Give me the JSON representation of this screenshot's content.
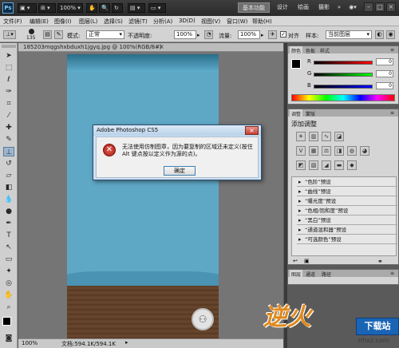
{
  "topbar": {
    "logo": "Ps",
    "zoom": "100%",
    "workspaces": [
      "基本功能",
      "设计",
      "绘画",
      "摄影"
    ],
    "window_buttons": [
      "–",
      "□",
      "×"
    ]
  },
  "menus": [
    "文件(F)",
    "编辑(E)",
    "图像(I)",
    "图层(L)",
    "选择(S)",
    "滤镜(T)",
    "分析(A)",
    "3D(D)",
    "视图(V)",
    "窗口(W)",
    "帮助(H)"
  ],
  "options": {
    "brush_size": "135",
    "mode_label": "模式:",
    "mode_value": "正常",
    "opacity_label": "不透明度:",
    "opacity_value": "100%",
    "flow_label": "流量:",
    "flow_value": "100%",
    "align_label": "对齐",
    "sample_label": "样本:",
    "sample_value": "当前图层"
  },
  "document": {
    "tab_title": "185203mqgshxbduxh1jgyq.jpg @ 100%(RGB/8#)",
    "close": "×",
    "zoom_status": "100%",
    "doc_info": "文档:594.1K/594.1K"
  },
  "dialog": {
    "title": "Adobe Photoshop CS5",
    "message": "无法使用仿制图章，因为要复制的区域还未定义(按住 Alt 键点按以定义作为源的点)。",
    "ok": "确定",
    "close": "×"
  },
  "color_panel": {
    "tabs": [
      "颜色",
      "色板",
      "样式"
    ],
    "channels": [
      {
        "label": "R",
        "value": "0"
      },
      {
        "label": "G",
        "value": "0"
      },
      {
        "label": "B",
        "value": "0"
      }
    ]
  },
  "adjust_panel": {
    "tabs": [
      "调整",
      "蒙版"
    ],
    "title": "添加调整",
    "presets": [
      "“色阶”预设",
      "“曲线”预设",
      "“曝光度”预设",
      "“色相/饱和度”预设",
      "“黑白”预设",
      "“通道混和器”预设",
      "“可选颜色”预设"
    ]
  },
  "layers_panel": {
    "tabs": [
      "图层",
      "通道",
      "路径"
    ]
  },
  "watermark": {
    "logo_text": "逆火",
    "badge": "下载站",
    "url": "nhxz.com"
  },
  "colors": {
    "fg": "#000000",
    "bg": "#ffffff",
    "dialog_accent": "#c54131"
  }
}
